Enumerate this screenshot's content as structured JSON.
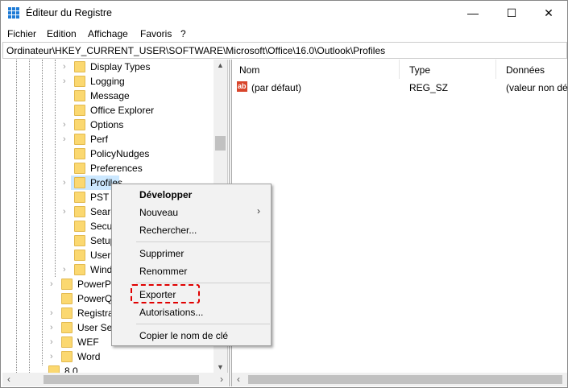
{
  "window": {
    "title": "Éditeur du Registre",
    "minimize": "—",
    "maximize": "☐",
    "close": "✕"
  },
  "menu": [
    "Fichier",
    "Edition",
    "Affichage",
    "Favoris",
    "?"
  ],
  "address": "Ordinateur\\HKEY_CURRENT_USER\\SOFTWARE\\Microsoft\\Office\\16.0\\Outlook\\Profiles",
  "tree": {
    "level1": [
      {
        "label": "Display Types",
        "expandable": true
      },
      {
        "label": "Logging",
        "expandable": true
      },
      {
        "label": "Message",
        "expandable": false
      },
      {
        "label": "Office Explorer",
        "expandable": false
      },
      {
        "label": "Options",
        "expandable": true
      },
      {
        "label": "Perf",
        "expandable": true
      },
      {
        "label": "PolicyNudges",
        "expandable": false
      },
      {
        "label": "Preferences",
        "expandable": false
      },
      {
        "label": "Profiles",
        "expandable": true,
        "selected": true
      },
      {
        "label": "PST",
        "expandable": false
      },
      {
        "label": "Searc",
        "expandable": true
      },
      {
        "label": "Secu",
        "expandable": false
      },
      {
        "label": "Setup",
        "expandable": false
      },
      {
        "label": "UserI",
        "expandable": false
      },
      {
        "label": "Wind",
        "expandable": true
      }
    ],
    "level0": [
      {
        "label": "PowerP",
        "expandable": true
      },
      {
        "label": "PowerQ",
        "expandable": false
      },
      {
        "label": "Registra",
        "expandable": true
      },
      {
        "label": "User Set",
        "expandable": true
      },
      {
        "label": "WEF",
        "expandable": true
      },
      {
        "label": "Word",
        "expandable": true
      }
    ],
    "parent": {
      "label": "8.0"
    }
  },
  "list": {
    "columns": [
      "Nom",
      "Type",
      "Données"
    ],
    "rows": [
      {
        "name": "(par défaut)",
        "type": "REG_SZ",
        "data": "(valeur non dé",
        "icon": "ab"
      }
    ]
  },
  "context_menu": {
    "items": [
      "Développer",
      "Nouveau",
      "Rechercher...",
      "Supprimer",
      "Renommer",
      "Exporter",
      "Autorisations...",
      "Copier le nom de clé"
    ],
    "highlighted": "Exporter",
    "highlight_color": "#e00000"
  }
}
